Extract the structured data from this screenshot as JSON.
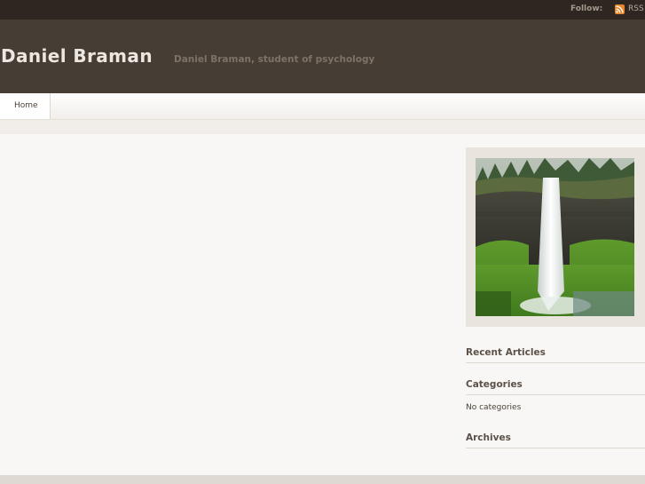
{
  "topbar": {
    "follow_label": "Follow:",
    "rss_label": "RSS",
    "rss_icon": "rss-icon"
  },
  "header": {
    "site_title": "Daniel Braman",
    "tagline": "Daniel Braman, student of psychology"
  },
  "nav": {
    "items": [
      {
        "label": "Home"
      }
    ]
  },
  "sidebar": {
    "image_subject": "waterfall-photo",
    "widgets": [
      {
        "title": "Recent Articles",
        "content": ""
      },
      {
        "title": "Categories",
        "content": "No categories"
      },
      {
        "title": "Archives",
        "content": ""
      }
    ]
  },
  "colors": {
    "topbar": "#2e2620",
    "header": "#463d34",
    "page_background": "#f8f7f6",
    "title_text": "#ece8e1",
    "tagline_text": "#7c7266"
  }
}
